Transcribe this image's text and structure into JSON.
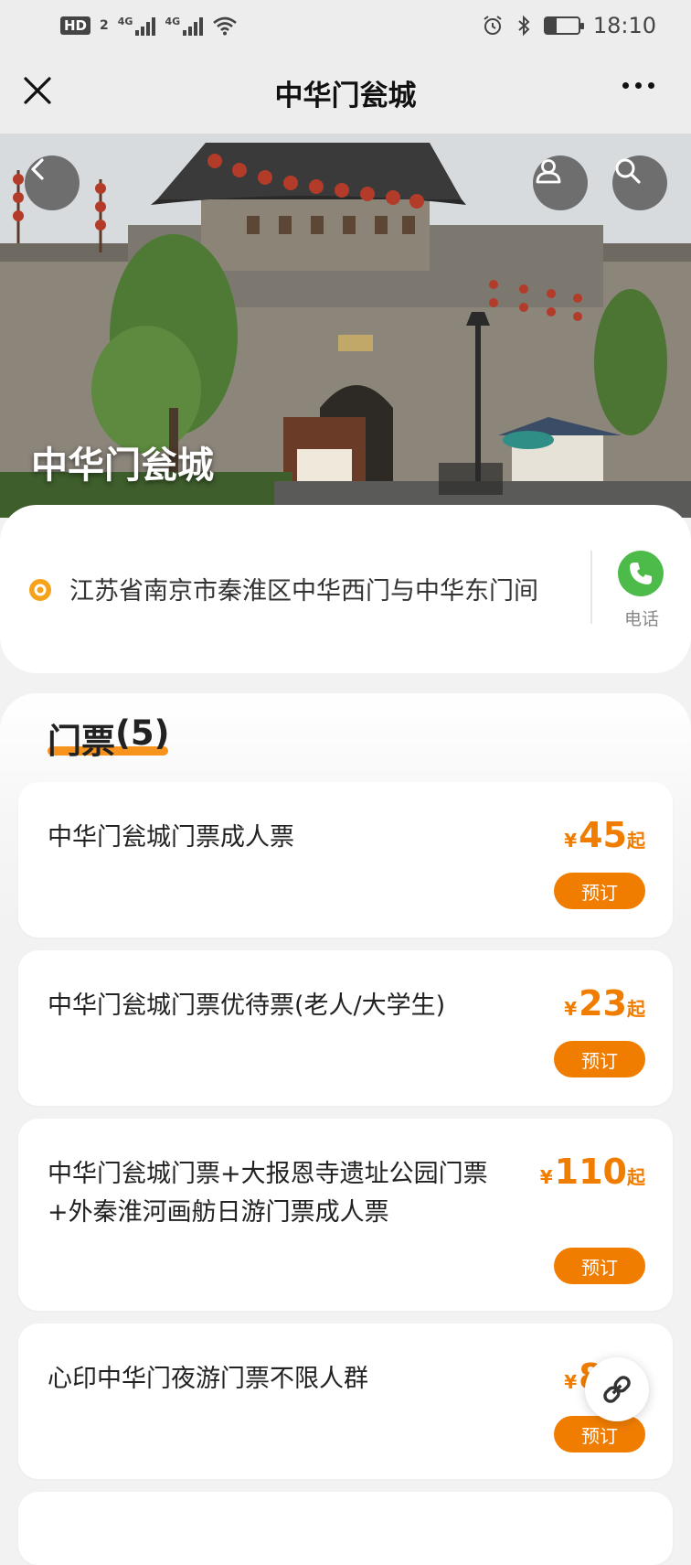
{
  "status_bar": {
    "left_badges": [
      "HD",
      "2"
    ],
    "signal_1": "4G",
    "signal_2": "4G",
    "time": "18:10",
    "battery_level": 0.35,
    "icons": [
      "hd-icon",
      "signal-icon",
      "wifi-icon",
      "alarm-icon",
      "bluetooth-icon",
      "battery-icon"
    ]
  },
  "navbar": {
    "title": "中华门瓮城"
  },
  "hero": {
    "title": "中华门瓮城"
  },
  "address": {
    "text": "江苏省南京市秦淮区中华西门与中华东门间",
    "phone_label": "电话"
  },
  "tickets": {
    "header": "门票",
    "count": "(5)",
    "items": [
      {
        "name": "中华门瓮城门票成人票",
        "currency": "¥",
        "price": "45",
        "suffix": "起",
        "book_label": "预订"
      },
      {
        "name": "中华门瓮城门票优待票(老人/大学生)",
        "currency": "¥",
        "price": "23",
        "suffix": "起",
        "book_label": "预订"
      },
      {
        "name": "中华门瓮城门票+大报恩寺遗址公园门票+外秦淮河画舫日游门票成人票",
        "currency": "¥",
        "price": "110",
        "suffix": "起",
        "book_label": "预订"
      },
      {
        "name": "心印中华门夜游门票不限人群",
        "currency": "¥",
        "price": "80",
        "suffix": "起",
        "book_label": "预订"
      }
    ]
  },
  "colors": {
    "accent": "#f07d00",
    "phone_green": "#4cbb4a",
    "background": "#f2f2f2"
  }
}
